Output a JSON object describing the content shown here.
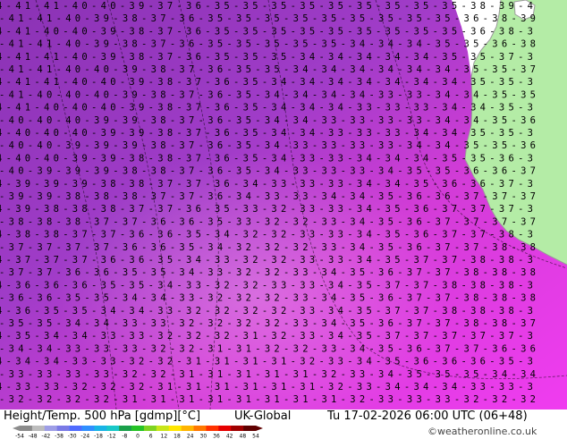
{
  "title": {
    "product": "Height/Temp. 500 hPa [gdmp][°C]",
    "model": "UK-Global",
    "valid": "Tu 17-02-2026 06:00 UTC (06+48)"
  },
  "credit": "©weatheronline.co.uk",
  "legend": {
    "ticks": [
      "-54",
      "-48",
      "-42",
      "-38",
      "-30",
      "-24",
      "-18",
      "-12",
      "-8",
      "0",
      "6",
      "12",
      "18",
      "24",
      "30",
      "36",
      "42",
      "48",
      "54"
    ],
    "colors": [
      "#8c8c8c",
      "#bdbdbd",
      "#9e9ee6",
      "#7a7ae6",
      "#4f6bff",
      "#2f8fff",
      "#19b4e6",
      "#19c8c8",
      "#1aa04a",
      "#26c326",
      "#7ed321",
      "#c8e619",
      "#ffe600",
      "#ffb400",
      "#ff7800",
      "#ff3200",
      "#e60000",
      "#a00000",
      "#600000"
    ]
  },
  "map": {
    "colors": {
      "land": "#b4eca6",
      "sea": "#ffffff",
      "coast": "#9a9a9a",
      "t_warm": "#f03cf0",
      "t_mid": "#d23cd7",
      "t_cold": "#a03cc8",
      "t_coldest": "#8a32b4",
      "contour": "#000000"
    },
    "rows": [
      "4-41-41-40-40-39-37-36-35-35-35-35-35-35-35-35-35-38-39-4",
      "-41-41-40-39-38-37-36-35-35-35-35-35-35-35-35-35-36-38-39",
      "4-41-40-40-39-38-37-36-35-35-35-35-35-35-35-35-35-36-38-3",
      "-41-41-40-39-38-37-36-35-35-35-35-35-34-34-34-35-35-36-38",
      "4-41-41-40-39-38-37-36-35-35-35-34-34-34-34-34-35-35-37-3",
      "-41-41-40-40-39-38-37-36-35-35-34-34-34-34-34-34-35-35-37",
      "4-41-41-40-40-39-38-37-36-35-34-34-34-34-34-34-34-35-35-3",
      "-41-40-40-40-39-38-37-36-35-34-34-34-34-33-33-34-34-35-35",
      "4-41-40-40-40-39-38-37-36-35-34-34-34-33-33-33-34-34-35-3",
      "-40-40-40-39-39-38-37-36-35-34-34-33-33-33-33-34-34-35-36",
      "4-40-40-40-39-39-38-37-36-35-34-34-33-33-33-34-34-35-35-3",
      "-40-40-39-39-39-38-37-36-35-34-33-33-33-33-34-34-35-35-36",
      "4-40-40-39-39-38-38-37-36-35-34-33-33-34-34-34-35-35-36-3",
      "-40-39-39-39-38-38-37-36-35-34-33-33-33-34-35-35-36-36-37",
      "4-39-39-39-38-38-37-37-36-34-33-33-33-34-34-35-36-36-37-3",
      "-39-39-38-38-38-37-37-36-34-33-33-34-34-35-36-36-37-37-37",
      "4-39-38-38-38-37-37-36-35-33-32-33-33-34-35-36-37-37-37-3",
      "-38-38-38-37-37-36-36-35-33-32-32-33-34-35-36-37-37-37-37",
      "4-38-38-37-37-36-36-35-34-32-32-33-33-34-35-36-37-37-38-3",
      "-37-37-37-37-36-36-35-34-32-32-32-33-34-35-36-37-37-38-38",
      "4-37-37-37-36-36-35-34-33-32-32-33-33-34-35-37-37-38-38-3",
      "-37-37-36-36-35-35-34-33-32-32-33-34-35-36-37-37-38-38-38",
      "4-36-36-36-35-35-34-33-32-32-33-33-34-35-37-37-38-38-38-3",
      "-36-36-35-35-34-34-33-32-32-32-33-34-35-36-37-37-38-38-38",
      "4-36-35-35-34-34-33-32-32-32-32-33-34-35-37-37-38-38-38-3",
      "-35-35-34-34-33-33-32-32-32-32-33-34-35-36-37-37-38-38-37",
      "4-35-34-34-33-33-32-32-32-31-32-33-34-35-37-37-37-37-37-3",
      "-34-34-33-33-33-32-32-31-31-32-32-33-34-35-36-37-37-36-36",
      "4-34-34-33-33-32-32-31-31-31-31-32-33-34-35-36-36-36-35-3",
      "-33-33-33-33-32-32-31-31-31-31-31-32-33-34-35-35-35-34-34",
      "4-33-33-32-32-32-31-31-31-31-31-31-32-33-34-34-34-33-33-3",
      "-32-32-32-32-31-31-31-31-31-31-31-31-32-33-33-33-32-32-32"
    ]
  }
}
